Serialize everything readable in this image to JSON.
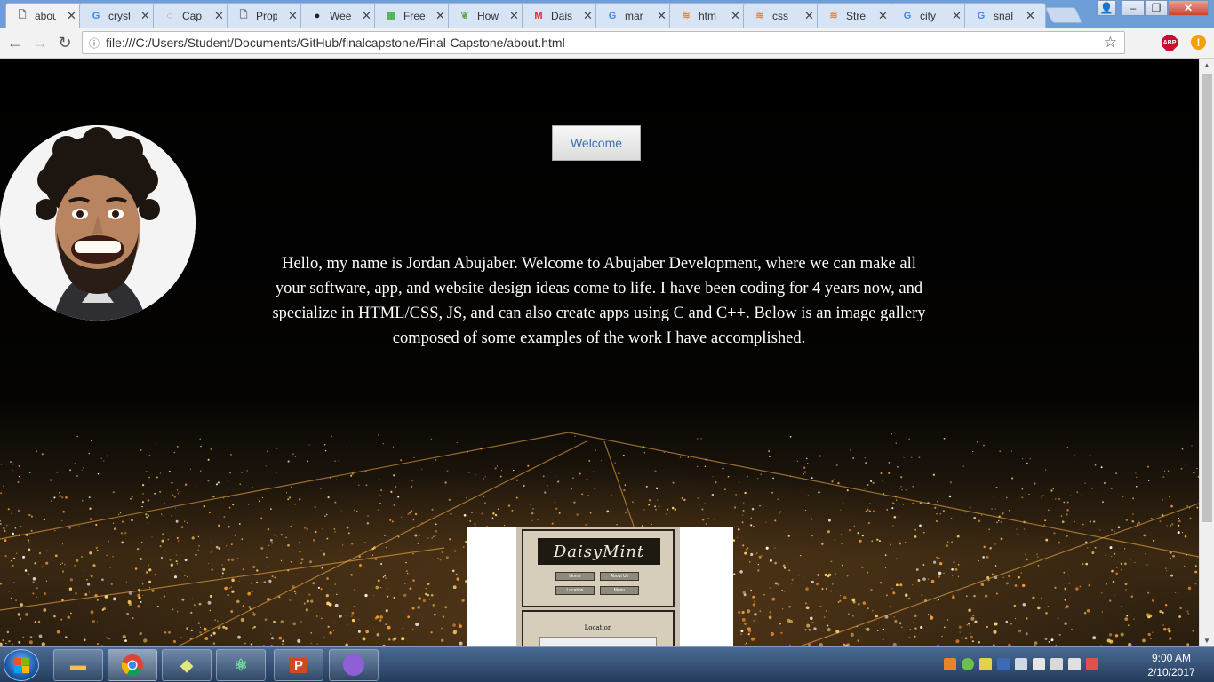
{
  "browser": {
    "tabs": [
      {
        "title": "abou",
        "favicon": "page-icon",
        "active": true
      },
      {
        "title": "cryst",
        "favicon": "google-icon"
      },
      {
        "title": "Cap",
        "favicon": "loading-icon"
      },
      {
        "title": "Prop",
        "favicon": "page-icon"
      },
      {
        "title": "Wee",
        "favicon": "github-icon"
      },
      {
        "title": "Free",
        "favicon": "grid-icon"
      },
      {
        "title": "How",
        "favicon": "leaf-icon"
      },
      {
        "title": "Dais",
        "favicon": "gmail-icon"
      },
      {
        "title": "mar",
        "favicon": "google-icon"
      },
      {
        "title": "htm",
        "favicon": "stackoverflow-icon"
      },
      {
        "title": "css",
        "favicon": "stackoverflow-icon"
      },
      {
        "title": "Stre",
        "favicon": "stackoverflow-icon"
      },
      {
        "title": "city",
        "favicon": "google-icon"
      },
      {
        "title": "snal",
        "favicon": "google-icon"
      }
    ],
    "url": "file:///C:/Users/Student/Documents/GitHub/finalcapstone/Final-Capstone/about.html",
    "extensions": {
      "abp": "ABP",
      "alert": "!"
    }
  },
  "page": {
    "welcome_label": "Welcome",
    "intro_text": "Hello, my name is Jordan Abujaber. Welcome to Abujaber Development, where we can make all your software, app, and website design ideas come to life. I have been coding for 4 years now, and specialize in HTML/CSS, JS, and can also create apps using C and C++. Below is an image gallery composed of some examples of the work I have accomplished.",
    "gallery_preview": {
      "logo": "DaisyMint",
      "nav": [
        "Home",
        "About Us",
        "Location",
        "Menu"
      ],
      "section_title": "Location"
    }
  },
  "taskbar": {
    "clock_time": "9:00 AM",
    "clock_date": "2/10/2017"
  },
  "colors": {
    "tabstrip": "#6d9ed8",
    "welcome_text": "#3d6fb0",
    "page_background": "#000000"
  }
}
